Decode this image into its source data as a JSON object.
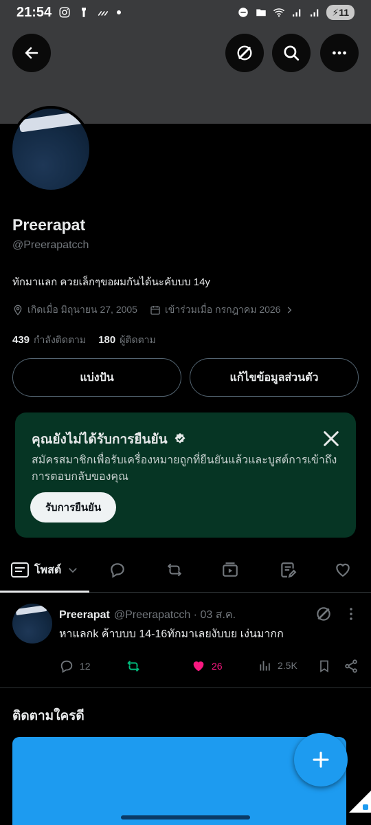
{
  "status": {
    "time": "21:54",
    "battery": "11"
  },
  "profile": {
    "name": "Preerapat",
    "handle": "@Preerapatcch",
    "bio": "ทักมาแลก ควยเล็กๆขอผมกันได้นะคับบบ  14y",
    "birthday": "เกิดเมื่อ มิถุนายน 27, 2005",
    "joined": "เข้าร่วมเมื่อ กรกฎาคม 2026",
    "following_count": "439",
    "following_label": "กำลังติดตาม",
    "followers_count": "180",
    "followers_label": "ผู้ติดตาม"
  },
  "buttons": {
    "share": "แบ่งปัน",
    "edit_profile": "แก้ไขข้อมูลส่วนตัว"
  },
  "verify_card": {
    "title": "คุณยังไม่ได้รับการยืนยัน",
    "description": "สมัครสมาชิกเพื่อรับเครื่องหมายถูกที่ยืนยันแล้วและบูสต์การเข้าถึงการตอบกลับของคุณ",
    "button": "รับการยืนยัน"
  },
  "tabs": {
    "posts_label": "โพสต์"
  },
  "post": {
    "name": "Preerapat",
    "handle_date": "@Preerapatcch · 03 ส.ค.",
    "text": "หาแลกk ค้าบบบ 14-16ทักมาเลยงับบย เง่นมากก",
    "replies": "12",
    "likes": "26",
    "views": "2.5K"
  },
  "section": {
    "who_to_follow": "ติดตามใครดี"
  },
  "colors": {
    "accent": "#1d9bf0",
    "like": "#f91880",
    "repost": "#00ba7c",
    "card_bg": "#063524"
  }
}
